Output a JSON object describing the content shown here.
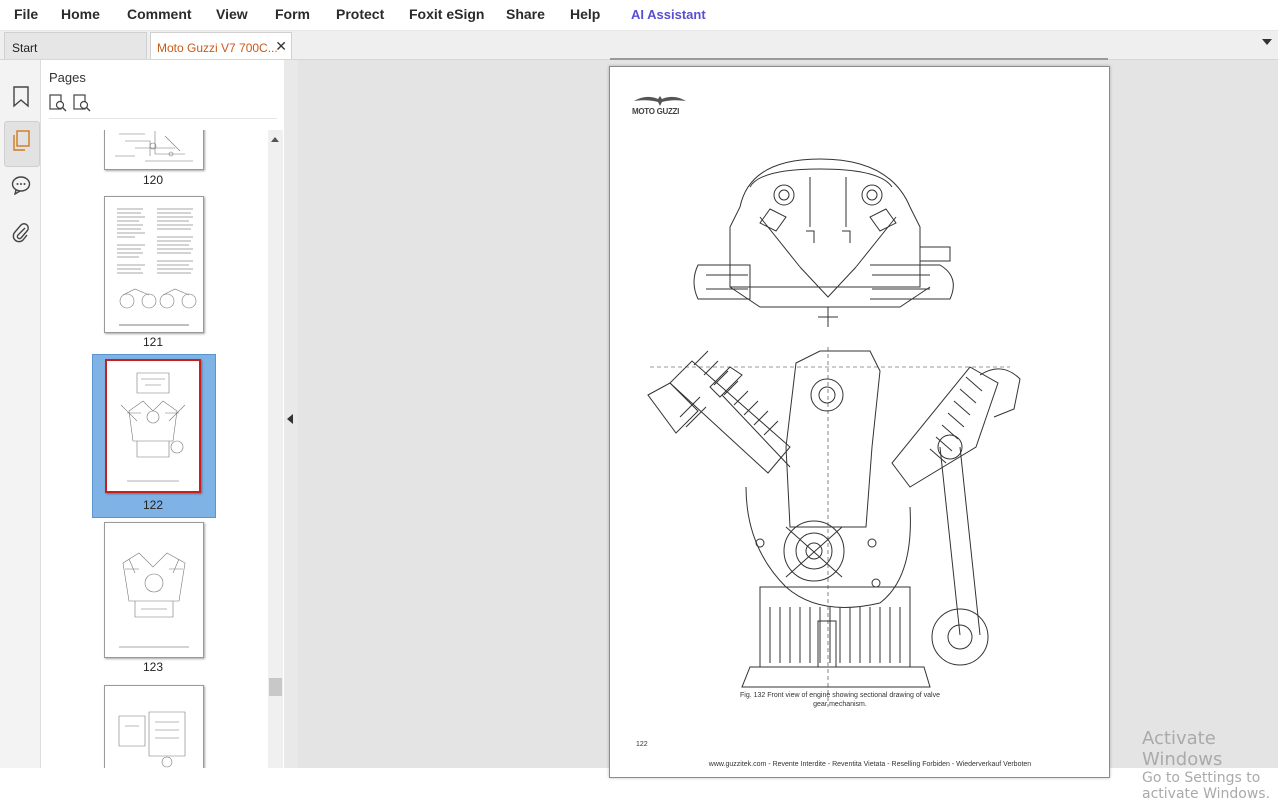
{
  "menu": {
    "file": "File",
    "home": "Home",
    "comment": "Comment",
    "view": "View",
    "form": "Form",
    "protect": "Protect",
    "esign": "Foxit eSign",
    "share": "Share",
    "help": "Help",
    "ai": "AI Assistant"
  },
  "tabs": {
    "start": "Start",
    "document": "Moto Guzzi V7 700C...",
    "close": "✕"
  },
  "sidebar": {
    "icons": [
      "bookmark-icon",
      "pages-icon",
      "comments-icon",
      "attachments-icon"
    ],
    "active": "pages-icon"
  },
  "pages_panel": {
    "title": "Pages",
    "thumbnails": [
      {
        "label": "120",
        "selected": false
      },
      {
        "label": "121",
        "selected": false
      },
      {
        "label": "122",
        "selected": true
      },
      {
        "label": "123",
        "selected": false
      },
      {
        "label": "",
        "selected": false
      }
    ]
  },
  "document_page": {
    "brand": "MOTO GUZZI",
    "caption_line1": "Fig. 132 Front view of engine showing sectional drawing of valve",
    "caption_line2": "gear mechanism.",
    "page_number": "122",
    "footer": "www.guzzitek.com - Revente Interdite - Reventita Vietata - Reselling Forbiden - Wiederverkauf Verboten"
  },
  "watermark": {
    "line1": "Activate Windows",
    "line2": "Go to Settings to activate Windows."
  },
  "colors": {
    "accent_tab_text": "#c85a17",
    "ai_text": "#5a4fd1",
    "selection": "#7fb3e6",
    "current_page_border": "#c81e1e"
  }
}
